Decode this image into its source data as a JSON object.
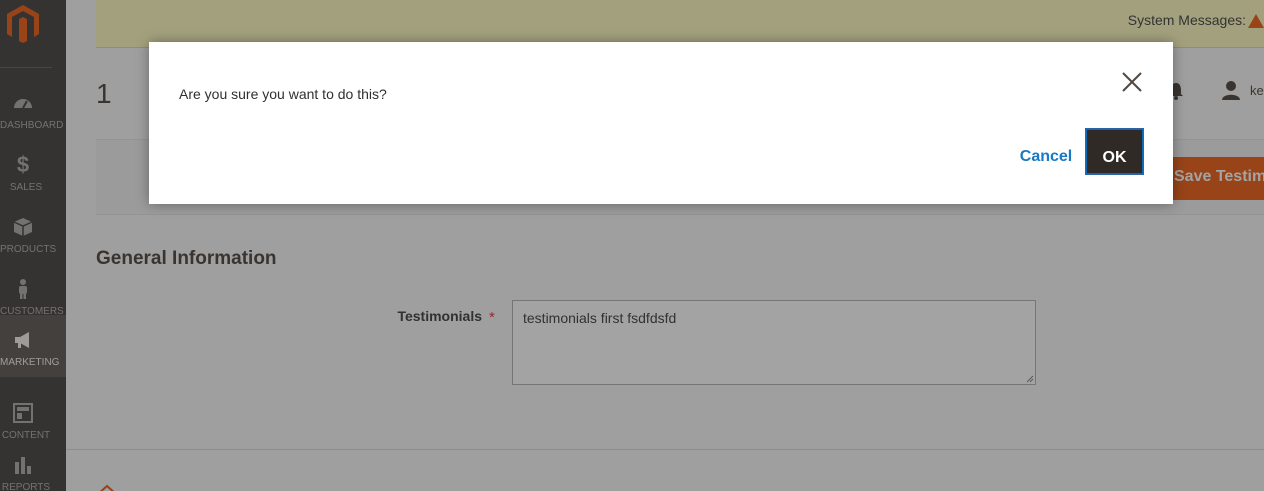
{
  "sidebar": {
    "items": [
      {
        "label": "DASHBOARD",
        "icon": "dashboard-icon"
      },
      {
        "label": "SALES",
        "icon": "dollar-icon"
      },
      {
        "label": "PRODUCTS",
        "icon": "box-icon"
      },
      {
        "label": "CUSTOMERS",
        "icon": "person-icon"
      },
      {
        "label": "MARKETING",
        "icon": "megaphone-icon"
      },
      {
        "label": "CONTENT",
        "icon": "layout-icon"
      },
      {
        "label": "REPORTS",
        "icon": "bar-chart-icon"
      }
    ],
    "active": "MARKETING"
  },
  "system_messages": {
    "label": "System Messages:"
  },
  "header": {
    "title": "1",
    "user_name": "ke"
  },
  "actions": {
    "save_label": "Save Testimonials Po"
  },
  "form": {
    "section_title": "General Information",
    "testimonials": {
      "label": "Testimonials",
      "required_mark": "*",
      "value": "testimonials first fsdfdsfd"
    }
  },
  "modal": {
    "message": "Are you sure you want to do this?",
    "cancel_label": "Cancel",
    "ok_label": "OK"
  },
  "colors": {
    "brand_orange": "#eb5202",
    "sidebar_bg": "#373330",
    "link_blue": "#1979c3"
  }
}
